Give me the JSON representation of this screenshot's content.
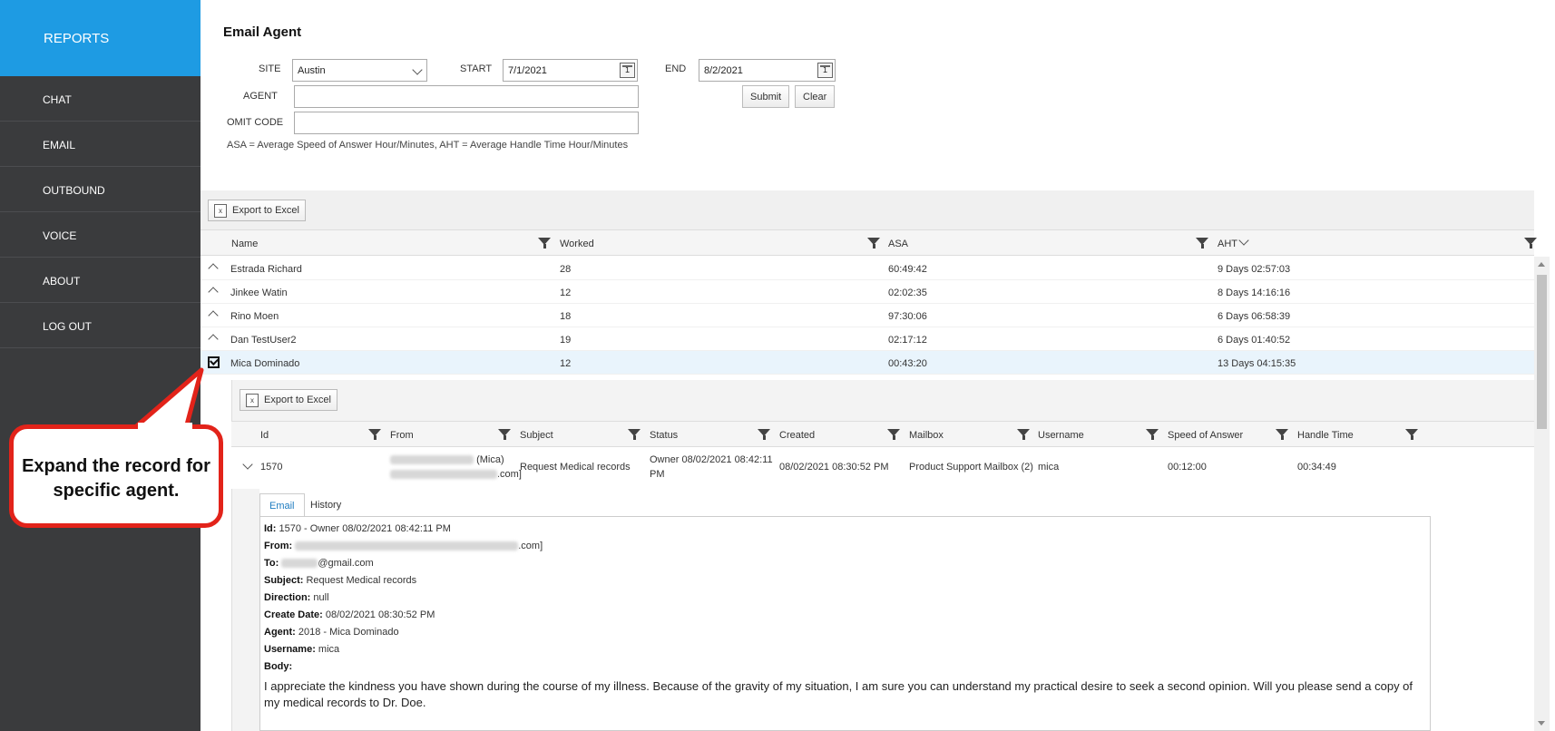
{
  "sidebar": {
    "brand": "REPORTS",
    "items": [
      {
        "label": "CHAT"
      },
      {
        "label": "EMAIL"
      },
      {
        "label": "OUTBOUND"
      },
      {
        "label": "VOICE"
      },
      {
        "label": "ABOUT"
      },
      {
        "label": "LOG OUT"
      }
    ]
  },
  "page": {
    "title": "Email Agent"
  },
  "filters": {
    "site_label": "SITE",
    "site_value": "Austin",
    "start_label": "START",
    "start_value": "7/1/2021",
    "end_label": "END",
    "end_value": "8/2/2021",
    "agent_label": "AGENT",
    "agent_value": "",
    "omit_label": "OMIT CODE",
    "omit_value": "",
    "submit_label": "Submit",
    "clear_label": "Clear",
    "calendar_icon_text": "1",
    "legend": "ASA = Average Speed of Answer Hour/Minutes, AHT = Average Handle Time Hour/Minutes"
  },
  "toolbar": {
    "export_label": "Export to Excel",
    "xls_icon_text": "x"
  },
  "grid": {
    "columns": [
      "Name",
      "Worked",
      "ASA",
      "AHT"
    ],
    "rows": [
      {
        "name": "Estrada Richard",
        "worked": "28",
        "asa": "60:49:42",
        "aht": "9 Days 02:57:03"
      },
      {
        "name": "Jinkee Watin",
        "worked": "12",
        "asa": "02:02:35",
        "aht": "8 Days 14:16:16"
      },
      {
        "name": "Rino Moen",
        "worked": "18",
        "asa": "97:30:06",
        "aht": "6 Days 06:58:39"
      },
      {
        "name": "Dan TestUser2",
        "worked": "19",
        "asa": "02:17:12",
        "aht": "6 Days 01:40:52"
      },
      {
        "name": "Mica Dominado",
        "worked": "12",
        "asa": "00:43:20",
        "aht": "13 Days 04:15:35"
      }
    ]
  },
  "detail": {
    "export_label": "Export to Excel",
    "columns": [
      "Id",
      "From",
      "Subject",
      "Status",
      "Created",
      "Mailbox",
      "Username",
      "Speed of Answer",
      "Handle Time"
    ],
    "row": {
      "id": "1570",
      "from_name_suffix": "(Mica)",
      "from_email_suffix": ".com]",
      "subject": "Request Medical records",
      "status_line1": "Owner 08/02/2021 08:42:11",
      "status_line2": "PM",
      "created": "08/02/2021 08:30:52 PM",
      "mailbox": "Product Support Mailbox (2)",
      "username": "mica",
      "speed": "00:12:00",
      "handle": "00:34:49"
    },
    "tabs": [
      "Email",
      "History"
    ],
    "email": {
      "id_label": "Id:",
      "id_value": "1570 - Owner 08/02/2021 08:42:11 PM",
      "from_label": "From:",
      "from_suffix": ".com]",
      "to_label": "To:",
      "to_suffix": "@gmail.com",
      "subject_label": "Subject:",
      "subject_value": "Request Medical records",
      "direction_label": "Direction:",
      "direction_value": "null",
      "create_label": "Create Date:",
      "create_value": "08/02/2021 08:30:52 PM",
      "agent_label": "Agent:",
      "agent_value": "2018 - Mica Dominado",
      "username_label": "Username:",
      "username_value": "mica",
      "body_label": "Body:",
      "body_text": "I appreciate the kindness you have shown during the course of my illness. Because of the gravity of my situation, I am sure you can understand my practical desire to seek a second opinion. Will you please send a copy of my medical records to Dr. Doe."
    }
  },
  "callout": {
    "text": "Expand the record for specific agent."
  },
  "colors": {
    "brand": "#1e9be3",
    "sidebar": "#3a3b3d",
    "callout_border": "#e2231a",
    "selected_row": "#e9f4fc"
  }
}
